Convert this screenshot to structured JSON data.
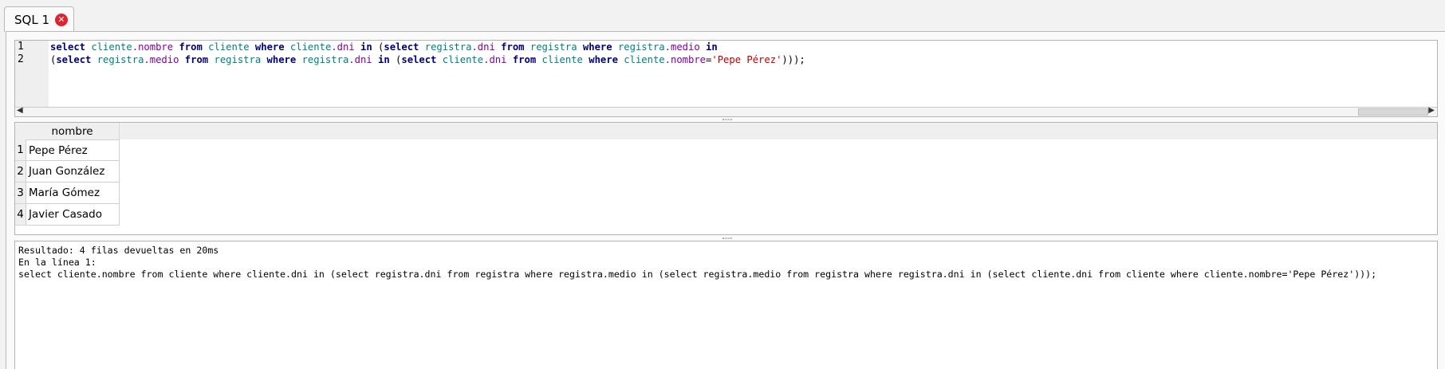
{
  "tab": {
    "label": "SQL 1"
  },
  "editor": {
    "line_numbers": [
      "1",
      "2"
    ],
    "line1": {
      "kw_select": "select",
      "t_cliente1": "cliente",
      "c_nombre1": ".nombre",
      "kw_from1": "from",
      "t_cliente2": "cliente",
      "kw_where1": "where",
      "t_cliente3": "cliente",
      "c_dni1": ".dni",
      "kw_in1": "in",
      "p_open1": "(",
      "kw_select2": "select",
      "t_registra1": "registra",
      "c_dni2": ".dni",
      "kw_from2": "from",
      "t_registra2": "registra",
      "kw_where2": "where",
      "t_registra3": "registra",
      "c_medio1": ".medio",
      "kw_in2": "in"
    },
    "line2": {
      "p_open": "(",
      "kw_select": "select",
      "t_registra1": "registra",
      "c_medio": ".medio",
      "kw_from1": "from",
      "t_registra2": "registra",
      "kw_where1": "where",
      "t_registra3": "registra",
      "c_dni1": ".dni",
      "kw_in": "in",
      "p_open2": "(",
      "kw_select2": "select",
      "t_cliente1": "cliente",
      "c_dni2": ".dni",
      "kw_from2": "from",
      "t_cliente2": "cliente",
      "kw_where2": "where",
      "t_cliente3": "cliente",
      "c_nombre": ".nombre",
      "eq": "=",
      "str": "'Pepe Pérez'",
      "close": ")));"
    }
  },
  "results": {
    "column": "nombre",
    "rows": [
      {
        "num": "1",
        "nombre": "Pepe Pérez"
      },
      {
        "num": "2",
        "nombre": "Juan González"
      },
      {
        "num": "3",
        "nombre": "María Gómez"
      },
      {
        "num": "4",
        "nombre": "Javier Casado"
      }
    ]
  },
  "log": {
    "line1": "Resultado: 4 filas devueltas en 20ms",
    "line2": "En la línea 1:",
    "line3": "select cliente.nombre from cliente where cliente.dni in (select registra.dni from registra where registra.medio in (select registra.medio from registra where registra.dni in (select cliente.dni from cliente where cliente.nombre='Pepe Pérez')));"
  },
  "colors": {
    "keyword": "#00007f",
    "table": "#008080",
    "column": "#8000a0",
    "string": "#c00000",
    "close_icon": "#e0232d"
  }
}
